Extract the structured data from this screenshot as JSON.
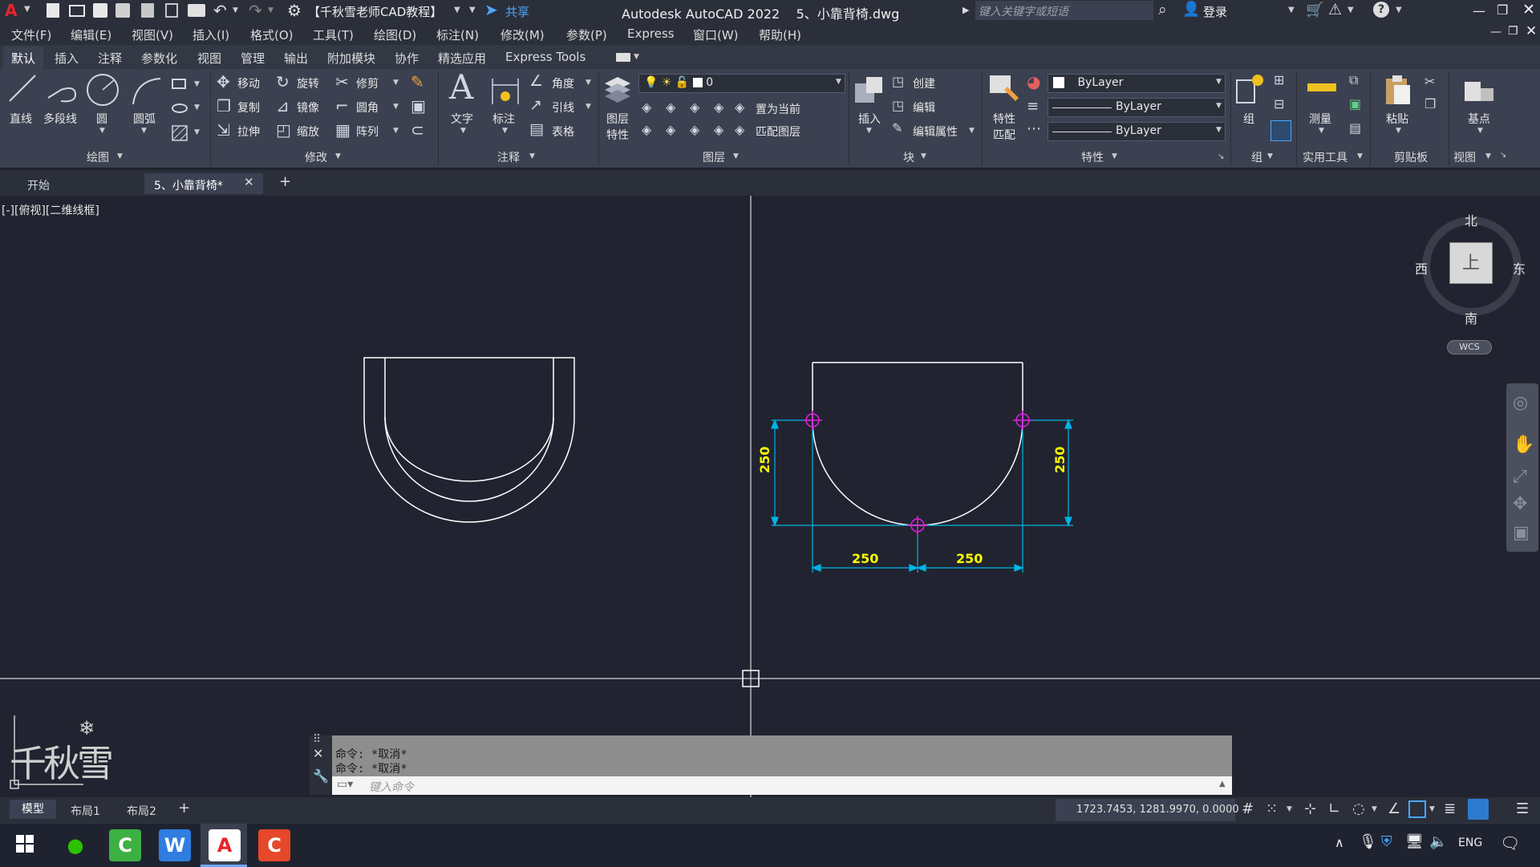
{
  "titlebar": {
    "app_logo": "A",
    "workspace": "【千秋雪老师CAD教程】",
    "share": "共享",
    "title": "Autodesk AutoCAD 2022    5、小靠背椅.dwg",
    "search_placeholder": "键入关键字或短语",
    "login": "登录"
  },
  "menubar": {
    "items": [
      "文件(F)",
      "编辑(E)",
      "视图(V)",
      "插入(I)",
      "格式(O)",
      "工具(T)",
      "绘图(D)",
      "标注(N)",
      "修改(M)",
      "参数(P)",
      "Express",
      "窗口(W)",
      "帮助(H)"
    ]
  },
  "ribbon_tabs": {
    "items": [
      "默认",
      "插入",
      "注释",
      "参数化",
      "视图",
      "管理",
      "输出",
      "附加模块",
      "协作",
      "精选应用",
      "Express Tools"
    ]
  },
  "ribbon": {
    "draw": {
      "line": "直线",
      "polyline": "多段线",
      "circle": "圆",
      "arc": "圆弧",
      "panel": "绘图"
    },
    "modify": {
      "move": "移动",
      "rotate": "旋转",
      "trim": "修剪",
      "copy": "复制",
      "mirror": "镜像",
      "fillet": "圆角",
      "stretch": "拉伸",
      "scale": "缩放",
      "array": "阵列",
      "panel": "修改"
    },
    "annotation": {
      "text": "文字",
      "dimension": "标注",
      "angular": "角度",
      "leader": "引线",
      "table": "表格",
      "panel": "注释"
    },
    "layers": {
      "layer_props_1": "图层",
      "layer_props_2": "特性",
      "current_layer": "0",
      "set_current": "置为当前",
      "match_layer": "匹配图层",
      "panel": "图层"
    },
    "block": {
      "insert": "插入",
      "create": "创建",
      "edit": "编辑",
      "edit_attr": "编辑属性",
      "panel": "块"
    },
    "properties": {
      "match_1": "特性",
      "match_2": "匹配",
      "color": "ByLayer",
      "linetype": "ByLayer",
      "lineweight": "ByLayer",
      "panel": "特性"
    },
    "groups": {
      "group": "组",
      "panel": "组"
    },
    "utilities": {
      "measure": "测量",
      "panel": "实用工具"
    },
    "clipboard": {
      "paste": "粘贴",
      "panel": "剪贴板"
    },
    "view": {
      "base": "基点",
      "panel": "视图"
    }
  },
  "doc_tabs": {
    "start": "开始",
    "active": "5、小靠背椅*"
  },
  "viewport": {
    "label": "[-][俯视][二维线框]",
    "compass": {
      "north": "北",
      "south": "南",
      "east": "东",
      "west": "西",
      "top": "上",
      "wcs": "WCS"
    },
    "dimensions": {
      "left_vertical": "250",
      "right_vertical": "250",
      "bottom_left": "250",
      "bottom_right": "250"
    },
    "watermark": "千秋雪"
  },
  "command": {
    "history": [
      "命令: *取消*",
      "命令: *取消*"
    ],
    "placeholder": "键入命令"
  },
  "layouts": {
    "tabs": [
      "模型",
      "布局1",
      "布局2"
    ]
  },
  "status": {
    "coords": "1723.7453, 1281.9970, 0.0000"
  },
  "tray": {
    "lang": "ENG"
  },
  "colors": {
    "dim": "#00b4e6",
    "dim_text": "#ffff00",
    "grip": "#e020e0",
    "line": "#ffffff"
  }
}
